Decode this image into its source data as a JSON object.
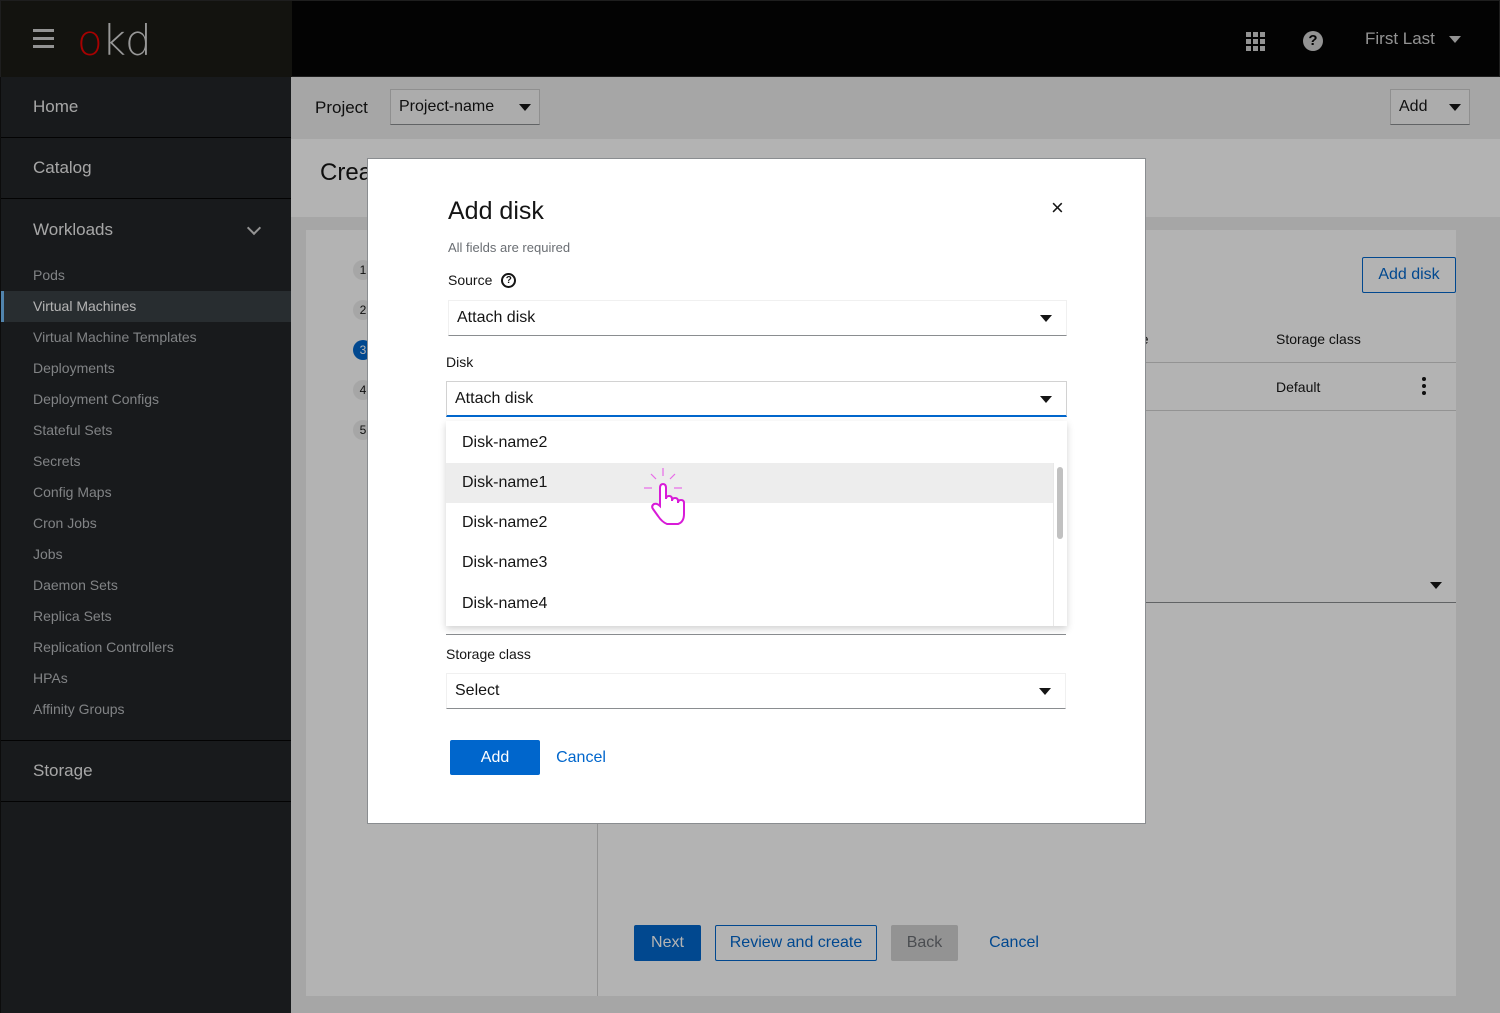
{
  "masthead": {
    "brand": {
      "o": "o",
      "kd": "kd"
    },
    "icons": {
      "menu": "hamburger-icon",
      "apps": "grid-icon",
      "help": "question-circle-icon"
    },
    "help_glyph": "?",
    "user": "First Last"
  },
  "sidebar": {
    "sections": [
      {
        "label": "Home"
      },
      {
        "label": "Catalog"
      }
    ],
    "workloads": {
      "label": "Workloads",
      "expanded": true,
      "items": [
        {
          "label": "Pods",
          "active": false
        },
        {
          "label": "Virtual Machines",
          "active": true
        },
        {
          "label": "Virtual Machine Templates",
          "active": false
        },
        {
          "label": "Deployments",
          "active": false
        },
        {
          "label": "Deployment Configs",
          "active": false
        },
        {
          "label": "Stateful Sets",
          "active": false
        },
        {
          "label": "Secrets",
          "active": false
        },
        {
          "label": "Config Maps",
          "active": false
        },
        {
          "label": "Cron Jobs",
          "active": false
        },
        {
          "label": "Jobs",
          "active": false
        },
        {
          "label": "Daemon Sets",
          "active": false
        },
        {
          "label": "Replica Sets",
          "active": false
        },
        {
          "label": "Replication Controllers",
          "active": false
        },
        {
          "label": "HPAs",
          "active": false
        },
        {
          "label": "Affinity Groups",
          "active": false
        }
      ]
    },
    "storage": {
      "label": "Storage"
    }
  },
  "toolbar": {
    "project_label": "Project",
    "project_value": "Project-name",
    "add_label": "Add"
  },
  "page": {
    "title_visible": "Crea",
    "steps": [
      "1",
      "2",
      "3",
      "4",
      "5"
    ],
    "current_step": 3,
    "add_disk_button": "Add disk",
    "table": {
      "headers": [
        "ace",
        "Storage class"
      ],
      "rows": [
        {
          "storage_class": "Default"
        }
      ]
    },
    "footer": {
      "next": "Next",
      "review": "Review and create",
      "back": "Back",
      "cancel": "Cancel"
    }
  },
  "modal": {
    "title": "Add disk",
    "close_glyph": "×",
    "required_note": "All fields are required",
    "source": {
      "label": "Source",
      "help_glyph": "?",
      "value": "Attach disk"
    },
    "disk": {
      "label": "Disk",
      "value": "Attach disk",
      "options": [
        "Disk-name2",
        "Disk-name1",
        "Disk-name2",
        "Disk-name3",
        "Disk-name4"
      ],
      "hovered_index": 1
    },
    "storage_class": {
      "label": "Storage class",
      "value": "Select"
    },
    "add_button": "Add",
    "cancel_button": "Cancel"
  },
  "colors": {
    "primary": "#0066cc",
    "masthead": "#030303",
    "sidebar": "#212427",
    "brand_red": "#ee0000",
    "cursor_magenta": "#e040e0"
  }
}
